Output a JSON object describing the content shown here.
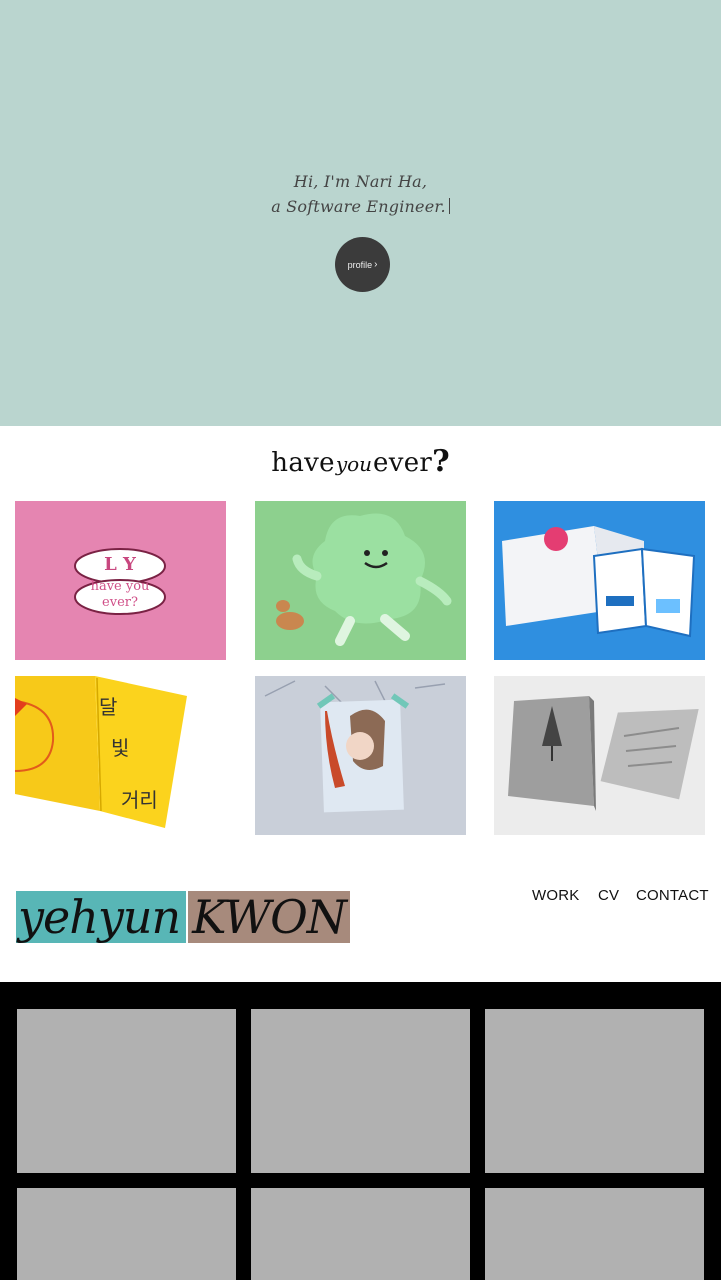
{
  "hero": {
    "line1": "Hi, I'm Nari Ha,",
    "line2": "a Software Engineer.",
    "profile_label": "profile",
    "profile_icon": "chevron-right-icon",
    "bg_color": "#bad5cf"
  },
  "have_you_ever": {
    "logo_part1": "have",
    "logo_part2": "you",
    "logo_part3": "ever",
    "logo_part4": "?",
    "cards": [
      {
        "name": "love-have-you-ever-card",
        "bg": "#e585b1",
        "sticker_line1": "L Y",
        "sticker_line2": "have you",
        "sticker_line3": "ever?"
      },
      {
        "name": "green-mascot-card",
        "bg": "#8dd08e"
      },
      {
        "name": "blue-brochure-card",
        "bg": "#2f8fe0"
      },
      {
        "name": "yellow-book-card",
        "bg": "#ffffff",
        "book_text1": "달",
        "book_text2": "빛",
        "book_text3": "거리"
      },
      {
        "name": "movie-poster-card",
        "bg": "#c9cfd9"
      },
      {
        "name": "snow-book-card",
        "bg": "#ececec"
      }
    ]
  },
  "yehyun": {
    "logo_part1": "yehyun",
    "logo_part2": "KWON",
    "nav": [
      "WORK",
      "CV",
      "CONTACT"
    ]
  },
  "gallery": {
    "tile_color": "#b1b1b1"
  }
}
